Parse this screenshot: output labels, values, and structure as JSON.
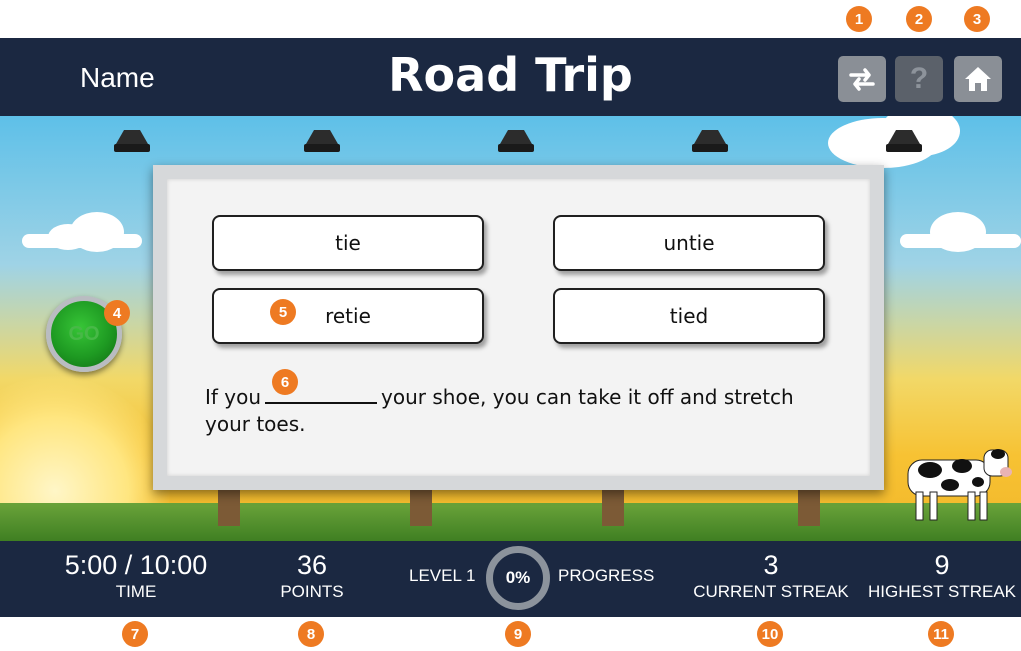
{
  "callouts": {
    "n1": "1",
    "n2": "2",
    "n3": "3",
    "n4": "4",
    "n5": "5",
    "n6": "6",
    "n7": "7",
    "n8": "8",
    "n9": "9",
    "n10": "10",
    "n11": "11"
  },
  "header": {
    "name_label": "Name",
    "title": "Road Trip",
    "icons": [
      "swap-icon",
      "help-icon",
      "home-icon"
    ],
    "help_label": "?"
  },
  "go_button": {
    "label": "GO"
  },
  "answers": [
    "tie",
    "untie",
    "retie",
    "tied"
  ],
  "question": {
    "before": "If you",
    "after": "your shoe, you can take it off and stretch your toes."
  },
  "stats": {
    "time_value": "5:00 / 10:00",
    "time_label": "TIME",
    "points_value": "36",
    "points_label": "POINTS",
    "level_label": "LEVEL 1",
    "progress_value": "0%",
    "progress_label": "PROGRESS",
    "current_streak_value": "3",
    "current_streak_label": "CURRENT STREAK",
    "highest_streak_value": "9",
    "highest_streak_label": "HIGHEST STREAK"
  },
  "colors": {
    "bar": "#1b2841",
    "callout": "#ee7a22",
    "go_green": "#1e9a22"
  }
}
